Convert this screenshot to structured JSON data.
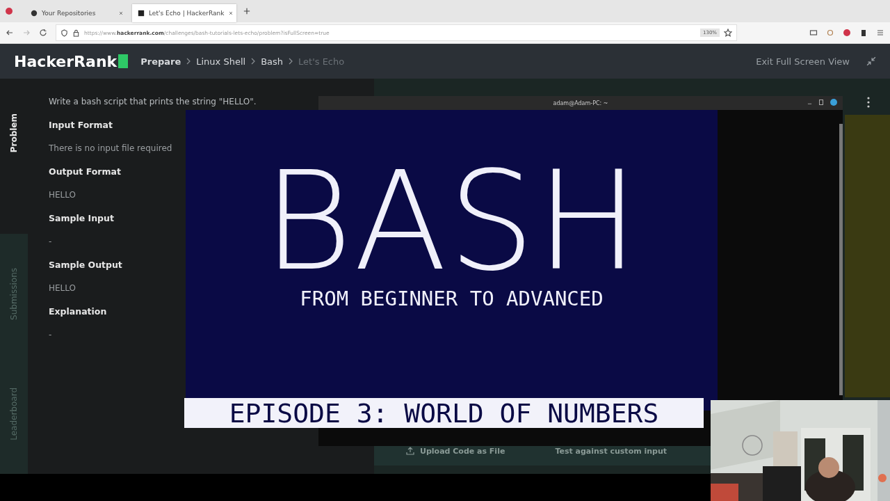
{
  "browser": {
    "tabs": [
      {
        "title": "Your Repositories",
        "selected": false
      },
      {
        "title": "Let's Echo | HackerRank",
        "selected": true
      }
    ],
    "url": "https://www.**hackerrank.com**/challenges/bash-tutorials-lets-echo/problem?isFullScreen=true",
    "zoom": "130%"
  },
  "header": {
    "logo": "HackerRank",
    "breadcrumb": [
      {
        "label": "Prepare",
        "current": false
      },
      {
        "label": "Linux Shell",
        "current": false
      },
      {
        "label": "Bash",
        "current": false
      },
      {
        "label": "Let's Echo",
        "current": true
      }
    ],
    "exit_label": "Exit Full Screen View"
  },
  "side_tabs": [
    {
      "label": "Problem",
      "selected": true
    },
    {
      "label": "Submissions",
      "selected": false
    },
    {
      "label": "Leaderboard",
      "selected": false
    }
  ],
  "problem": {
    "intro": "Write a bash script that prints the string \"HELLO\".",
    "sections": [
      {
        "heading": "Input Format",
        "body": "There is no input file required"
      },
      {
        "heading": "Output Format",
        "body": "HELLO"
      },
      {
        "heading": "Sample Input",
        "body": "-"
      },
      {
        "heading": "Sample Output",
        "body": "HELLO"
      },
      {
        "heading": "Explanation",
        "body": "-"
      }
    ]
  },
  "editor": {
    "upload": "Upload Code as File",
    "test": "Test against custom input"
  },
  "terminal": {
    "title": "adam@Adam-PC: ~"
  },
  "title_card": {
    "title": "BASH",
    "subtitle": "FROM BEGINNER TO ADVANCED",
    "episode": "EPISODE 3: WORLD OF NUMBERS"
  }
}
